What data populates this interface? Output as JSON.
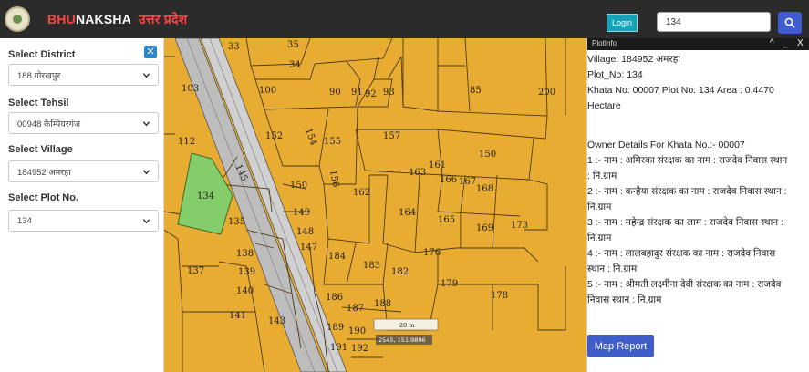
{
  "header": {
    "brand_part1": "BHU",
    "brand_part2": "NAKSHA",
    "brand_state": "उत्तर प्रदेश",
    "login_label": "Login",
    "search_value": "134",
    "search_icon": "search-icon"
  },
  "sidebar": {
    "close_glyph": "✕",
    "fields": [
      {
        "label": "Select District",
        "value": "188 गोरखपुर"
      },
      {
        "label": "Select Tehsil",
        "value": "00948 कैम्पियरगंज"
      },
      {
        "label": "Select Village",
        "value": "184952 अमरहा"
      },
      {
        "label": "Select Plot No.",
        "value": "134"
      }
    ]
  },
  "map": {
    "scale_label": "20 m",
    "coord_readout": "2545, 151.9896",
    "selected_plot": "134",
    "plot_labels": [
      "33",
      "34",
      "35",
      "100",
      "103",
      "90",
      "91",
      "92",
      "93",
      "85",
      "200",
      "112",
      "152",
      "154",
      "155",
      "157",
      "150",
      "163",
      "161",
      "166",
      "167",
      "168",
      "150",
      "162",
      "164",
      "165",
      "169",
      "173",
      "134",
      "135",
      "149",
      "148",
      "147",
      "184",
      "183",
      "182",
      "179",
      "178",
      "138",
      "137",
      "139",
      "140",
      "141",
      "143",
      "186",
      "187",
      "188",
      "189",
      "190",
      "191",
      "192",
      "176",
      "145",
      "156"
    ],
    "colors": {
      "plot_fill": "#e9ac32",
      "selected_fill": "#85cc6a",
      "road_fill": "#b9b9b9",
      "line": "#5a4520"
    }
  },
  "panel": {
    "title": "PlotInfo",
    "controls": [
      "^",
      "_",
      "X"
    ],
    "lines": [
      "Village: 184952 अमरहा",
      "Plot_No: 134",
      "Khata No: 00007 Plot No: 134 Area : 0.4470",
      "Hectare",
      "",
      "",
      "Owner Details For Khata No.:- 00007",
      "1 :- नाम : अमिरका संरक्षक का नाम : राजदेव निवास स्थान",
      ": नि.ग्राम",
      "2 :- नाम : कन्हैया संरक्षक का नाम : राजदेव निवास स्थान :",
      "नि.ग्राम",
      "3 :- नाम : महेन्द्र संरक्षक का लाम : राजदेव निवास स्थान :",
      "नि.ग्राम",
      "4 :- नाम : लालबहादुर संरक्षक का नाम : राजदेव निवास",
      "स्थान : नि.ग्राम",
      "5 :- नाम : श्रीमती लक्ष्मीना देवी संरक्षक का नाम : राजदेव",
      "निवास स्थान : नि.ग्राम"
    ],
    "map_report_label": "Map Report"
  }
}
